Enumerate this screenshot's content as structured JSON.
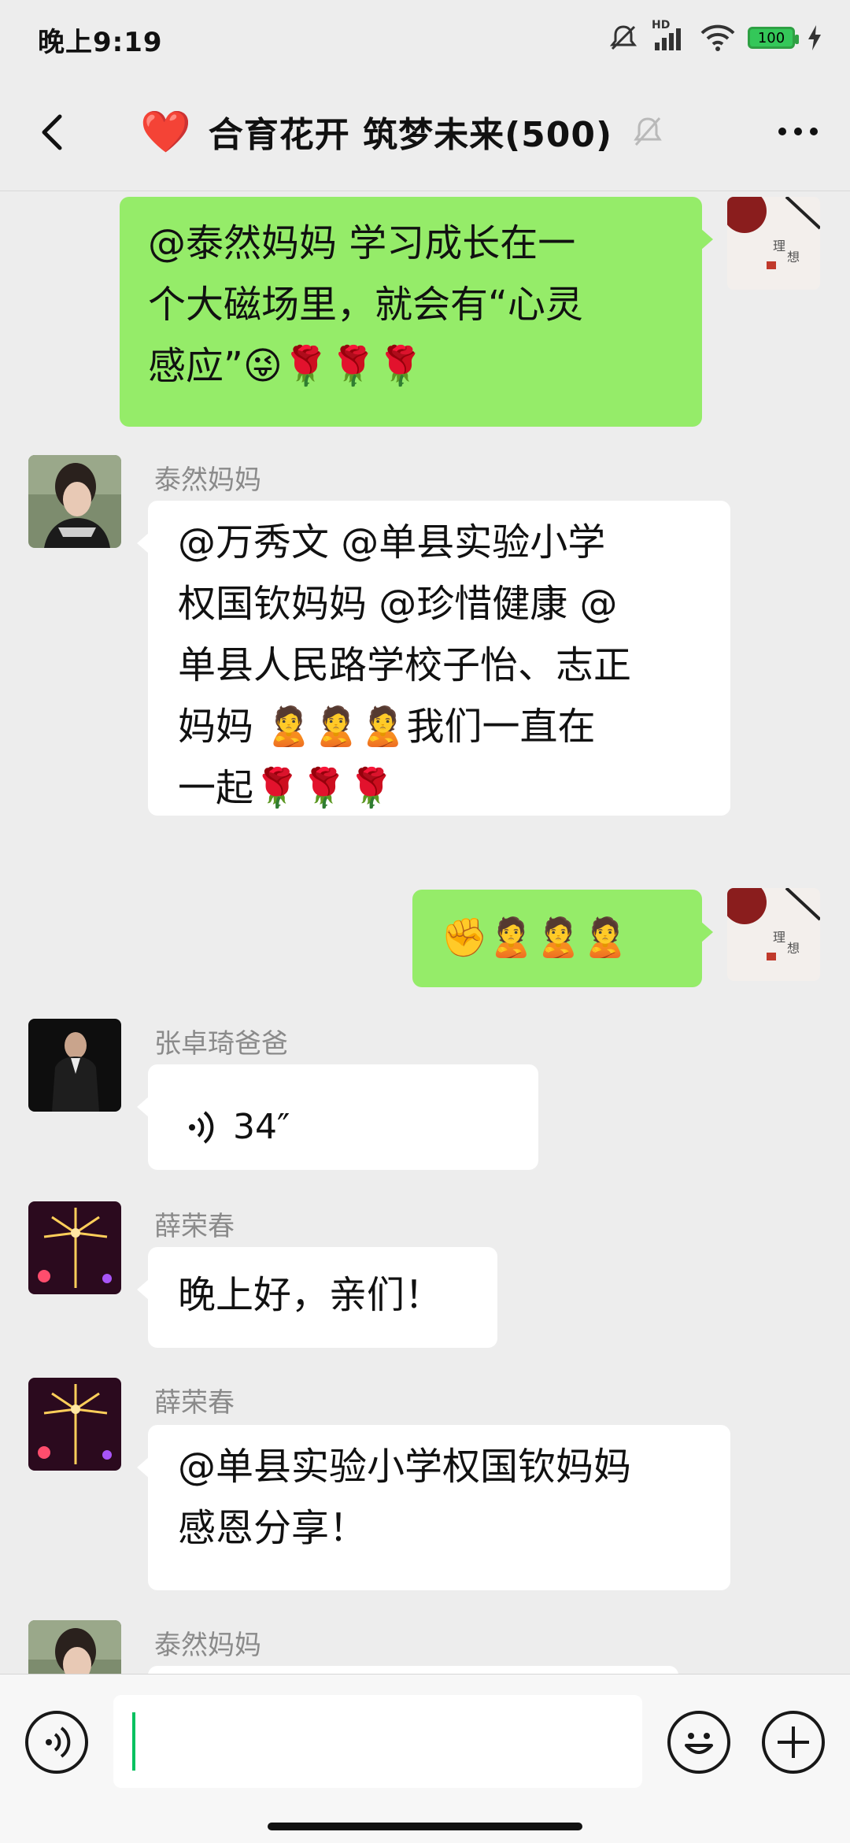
{
  "status": {
    "time": "晚上9:19",
    "battery": "100",
    "network": "HD"
  },
  "header": {
    "heart": "❤️",
    "title": "合育花开 筑梦未来(500)"
  },
  "messages": [
    {
      "side": "out",
      "text_lines": [
        "@泰然妈妈  学习成长在一",
        "个大磁场里，就会有“心灵",
        "感应”😜🌹🌹🌹"
      ]
    },
    {
      "side": "in",
      "name": "泰然妈妈",
      "text_lines": [
        "@万秀文  @单县实验小学",
        "权国钦妈妈  @珍惜健康  @",
        "单县人民路学校子怡、志正",
        "妈妈  🙎🙎🙎我们一直在",
        "一起🌹🌹🌹"
      ]
    },
    {
      "side": "out",
      "text_lines": [
        "✊🙎🙎🙎"
      ]
    },
    {
      "side": "in",
      "name": "张卓琦爸爸",
      "voice": "34″"
    },
    {
      "side": "in",
      "name": "薛荣春",
      "text_lines": [
        "晚上好，亲们！"
      ]
    },
    {
      "side": "in",
      "name": "薛荣春",
      "text_lines": [
        "@单县实验小学权国钦妈妈",
        " 感恩分享！"
      ]
    },
    {
      "side": "in",
      "name": "泰然妈妈"
    }
  ],
  "input": {
    "value": ""
  }
}
